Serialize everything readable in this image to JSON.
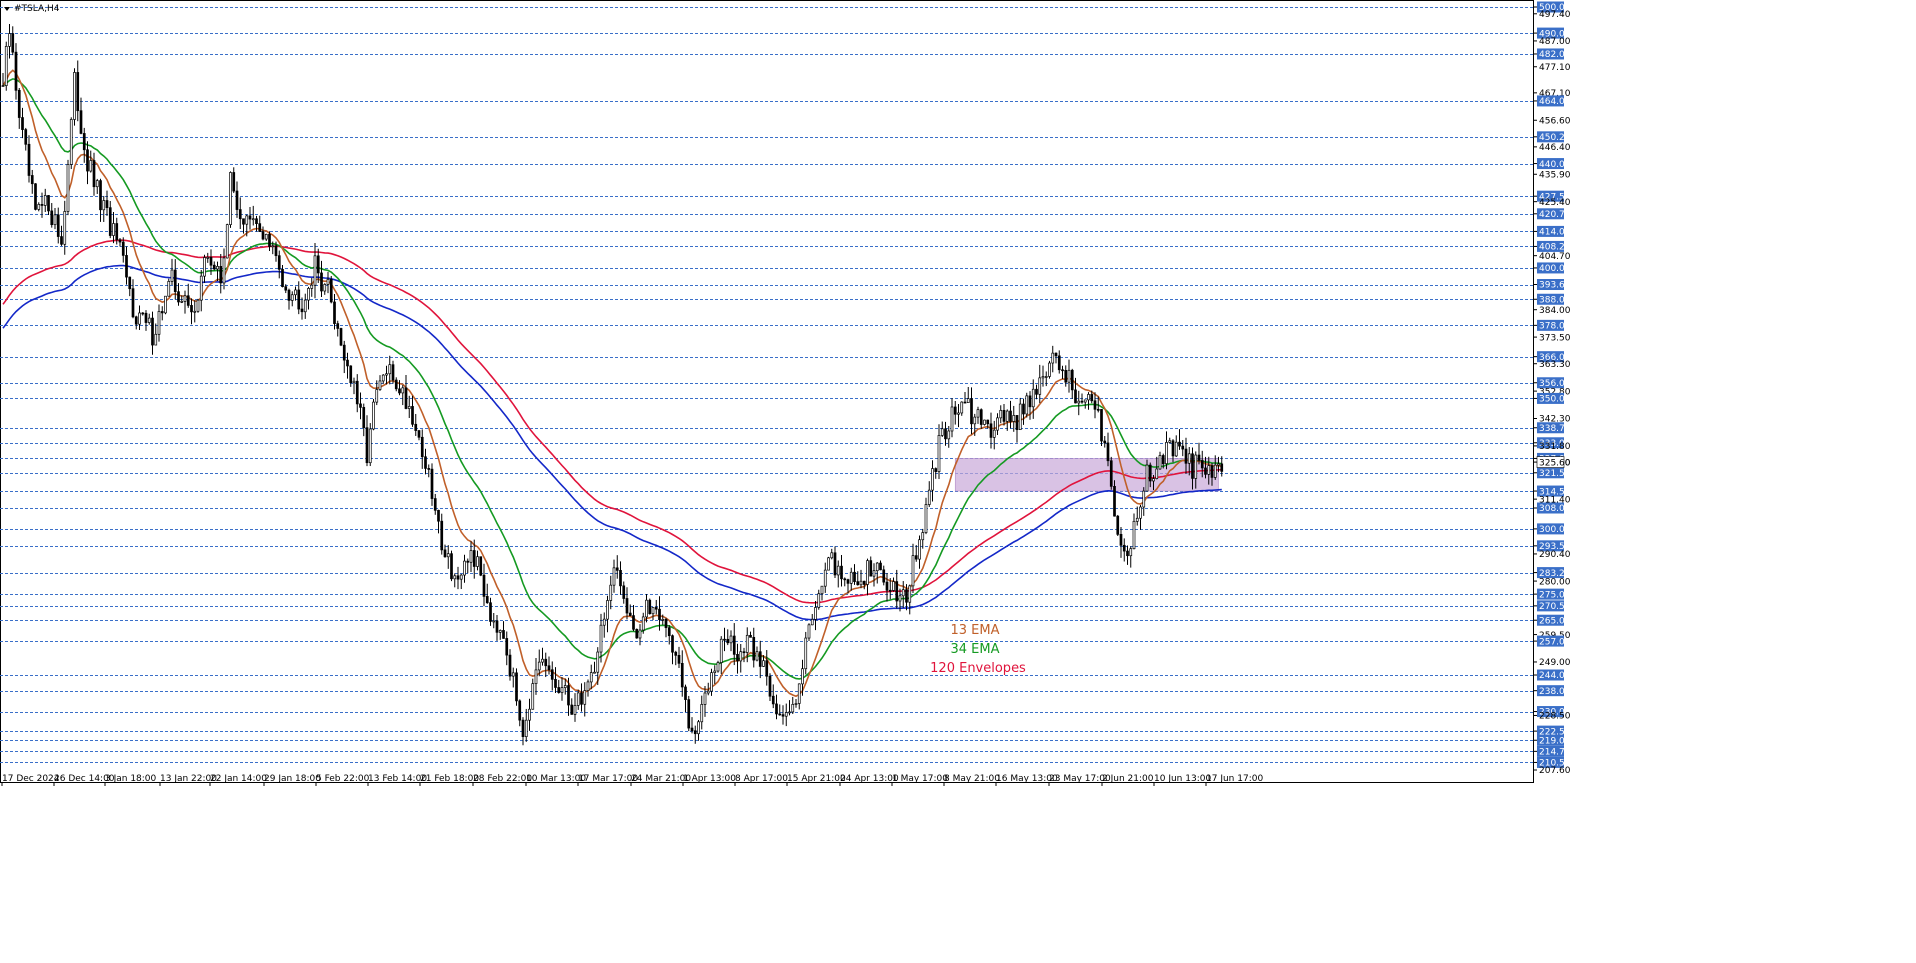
{
  "chart_data": {
    "type": "candlestick",
    "symbol_label": "#TSLA,H4",
    "y_axis_ticks": [
      500.0,
      497.4,
      490.0,
      487.0,
      482.0,
      477.1,
      467.1,
      464.0,
      456.6,
      450.25,
      446.4,
      440.0,
      435.9,
      427.5,
      425.4,
      420.75,
      414.0,
      408.25,
      404.7,
      400.0,
      393.65,
      388.0,
      384.0,
      378.0,
      373.5,
      366.0,
      363.3,
      356.0,
      352.8,
      350.0,
      342.3,
      338.75,
      333.0,
      331.8,
      327.0,
      325.6,
      321.5,
      314.5,
      311.4,
      308.0,
      300.0,
      293.5,
      290.4,
      283.25,
      280.0,
      275.0,
      270.5,
      265.0,
      259.5,
      257.0,
      249.0,
      244.0,
      238.0,
      230.0,
      228.5,
      222.5,
      219.0,
      214.75,
      210.5,
      207.6
    ],
    "highlighted_levels": [
      500.0,
      490.0,
      482.0,
      464.0,
      450.25,
      440.0,
      427.5,
      420.75,
      414.0,
      408.25,
      400.0,
      393.65,
      388.0,
      378.0,
      366.0,
      356.0,
      350.0,
      338.75,
      333.0,
      327.0,
      321.5,
      314.5,
      308.0,
      300.0,
      293.5,
      283.25,
      275.0,
      270.5,
      265.0,
      257.0,
      244.0,
      238.0,
      230.0,
      222.5,
      219.0,
      214.75,
      210.5
    ],
    "current_price": 325.6,
    "x_tick_labels": [
      "17 Dec 2024",
      "26 Dec 14:00",
      "3 Jan 18:00",
      "13 Jan 22:00",
      "22 Jan 14:00",
      "29 Jan 18:00",
      "5 Feb 22:00",
      "13 Feb 14:00",
      "21 Feb 18:00",
      "28 Feb 22:00",
      "10 Mar 13:00",
      "17 Mar 17:00",
      "24 Mar 21:00",
      "1 Apr 13:00",
      "8 Apr 17:00",
      "15 Apr 21:00",
      "24 Apr 13:00",
      "1 May 17:00",
      "8 May 21:00",
      "16 May 13:00",
      "23 May 17:00",
      "2 Jun 21:00",
      "10 Jun 13:00",
      "17 Jun 17:00"
    ],
    "anchors": [
      [
        0,
        470
      ],
      [
        2,
        490
      ],
      [
        6,
        450
      ],
      [
        10,
        420
      ],
      [
        14,
        425
      ],
      [
        18,
        410
      ],
      [
        22,
        470
      ],
      [
        26,
        440
      ],
      [
        30,
        425
      ],
      [
        35,
        410
      ],
      [
        40,
        385
      ],
      [
        46,
        375
      ],
      [
        52,
        395
      ],
      [
        58,
        382
      ],
      [
        63,
        405
      ],
      [
        67,
        395
      ],
      [
        70,
        432
      ],
      [
        74,
        418
      ],
      [
        80,
        414
      ],
      [
        85,
        400
      ],
      [
        88,
        392
      ],
      [
        92,
        388
      ],
      [
        96,
        400
      ],
      [
        100,
        392
      ],
      [
        104,
        372
      ],
      [
        109,
        348
      ],
      [
        112,
        330
      ],
      [
        115,
        352
      ],
      [
        118,
        360
      ],
      [
        122,
        355
      ],
      [
        126,
        344
      ],
      [
        130,
        325
      ],
      [
        134,
        300
      ],
      [
        138,
        285
      ],
      [
        141,
        278
      ],
      [
        144,
        292
      ],
      [
        147,
        282
      ],
      [
        150,
        268
      ],
      [
        154,
        262
      ],
      [
        157,
        240
      ],
      [
        160,
        225
      ],
      [
        163,
        238
      ],
      [
        166,
        248
      ],
      [
        170,
        240
      ],
      [
        173,
        235
      ],
      [
        176,
        232
      ],
      [
        179,
        238
      ],
      [
        182,
        248
      ],
      [
        185,
        268
      ],
      [
        188,
        282
      ],
      [
        192,
        272
      ],
      [
        195,
        260
      ],
      [
        198,
        268
      ],
      [
        201,
        272
      ],
      [
        204,
        262
      ],
      [
        207,
        252
      ],
      [
        210,
        232
      ],
      [
        212,
        218
      ],
      [
        215,
        230
      ],
      [
        218,
        248
      ],
      [
        222,
        258
      ],
      [
        226,
        252
      ],
      [
        230,
        255
      ],
      [
        234,
        248
      ],
      [
        238,
        232
      ],
      [
        240,
        225
      ],
      [
        243,
        232
      ],
      [
        246,
        250
      ],
      [
        249,
        268
      ],
      [
        252,
        282
      ],
      [
        255,
        286
      ],
      [
        258,
        284
      ],
      [
        262,
        278
      ],
      [
        266,
        285
      ],
      [
        270,
        282
      ],
      [
        274,
        278
      ],
      [
        278,
        275
      ],
      [
        282,
        295
      ],
      [
        285,
        312
      ],
      [
        288,
        332
      ],
      [
        291,
        342
      ],
      [
        295,
        348
      ],
      [
        299,
        342
      ],
      [
        303,
        338
      ],
      [
        307,
        346
      ],
      [
        311,
        340
      ],
      [
        315,
        350
      ],
      [
        319,
        356
      ],
      [
        323,
        364
      ],
      [
        327,
        360
      ],
      [
        330,
        352
      ],
      [
        333,
        348
      ],
      [
        336,
        345
      ],
      [
        339,
        335
      ],
      [
        341,
        320
      ],
      [
        343,
        298
      ],
      [
        345,
        290
      ],
      [
        348,
        300
      ],
      [
        352,
        320
      ],
      [
        356,
        328
      ],
      [
        360,
        330
      ],
      [
        364,
        325
      ],
      [
        368,
        323
      ],
      [
        372,
        322
      ],
      [
        374,
        325
      ]
    ],
    "legend_items": [
      {
        "label": "13 EMA",
        "color": "#c0602a"
      },
      {
        "label": "34 EMA",
        "color": "#159a22"
      },
      {
        "label": "120 Envelopes",
        "color": "#e0143c"
      }
    ],
    "zone": {
      "low": 314.5,
      "high": 327.0
    },
    "colors": {
      "grid": "#3a6fc8",
      "badge": "#3a6fc8",
      "candle": "#000000",
      "env_upper": "#e0143c",
      "env_lower": "#1428c8",
      "ema13": "#c0602a",
      "ema34": "#159a22",
      "zone": "#c9a8d8"
    }
  }
}
